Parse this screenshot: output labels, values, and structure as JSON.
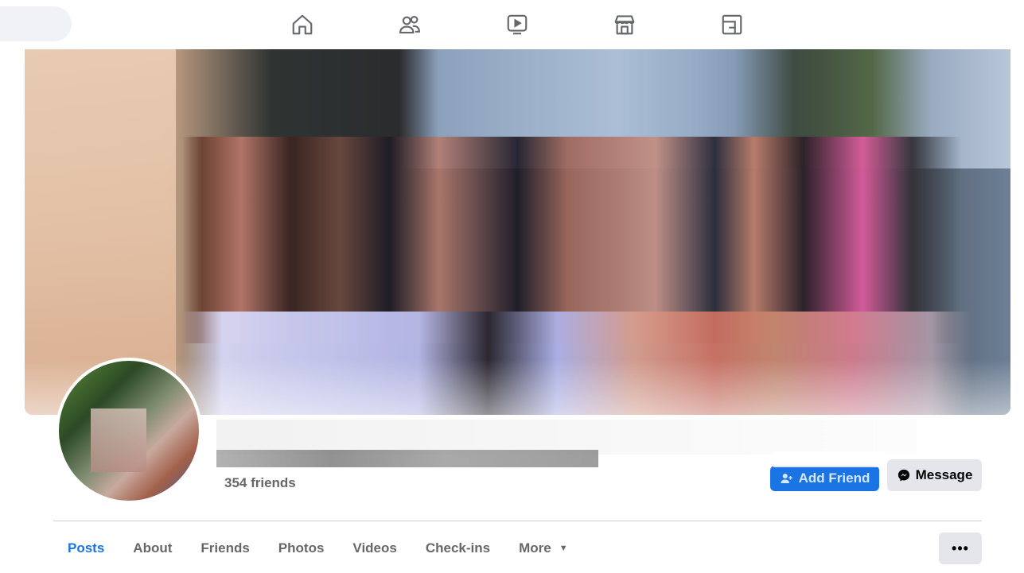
{
  "topnav": {
    "icons": [
      "home-icon",
      "friends-icon",
      "watch-icon",
      "marketplace-icon",
      "gaming-icon"
    ]
  },
  "profile": {
    "friends_count": "354 friends"
  },
  "actions": {
    "add_friend_label": "Add Friend",
    "message_label": "Message"
  },
  "tabs": [
    {
      "label": "Posts",
      "active": true
    },
    {
      "label": "About"
    },
    {
      "label": "Friends"
    },
    {
      "label": "Photos"
    },
    {
      "label": "Videos"
    },
    {
      "label": "Check-ins"
    },
    {
      "label": "More"
    }
  ],
  "more_menu": {
    "label": "•••"
  },
  "colors": {
    "accent": "#1b74e4",
    "secondary_text": "#65676b"
  }
}
